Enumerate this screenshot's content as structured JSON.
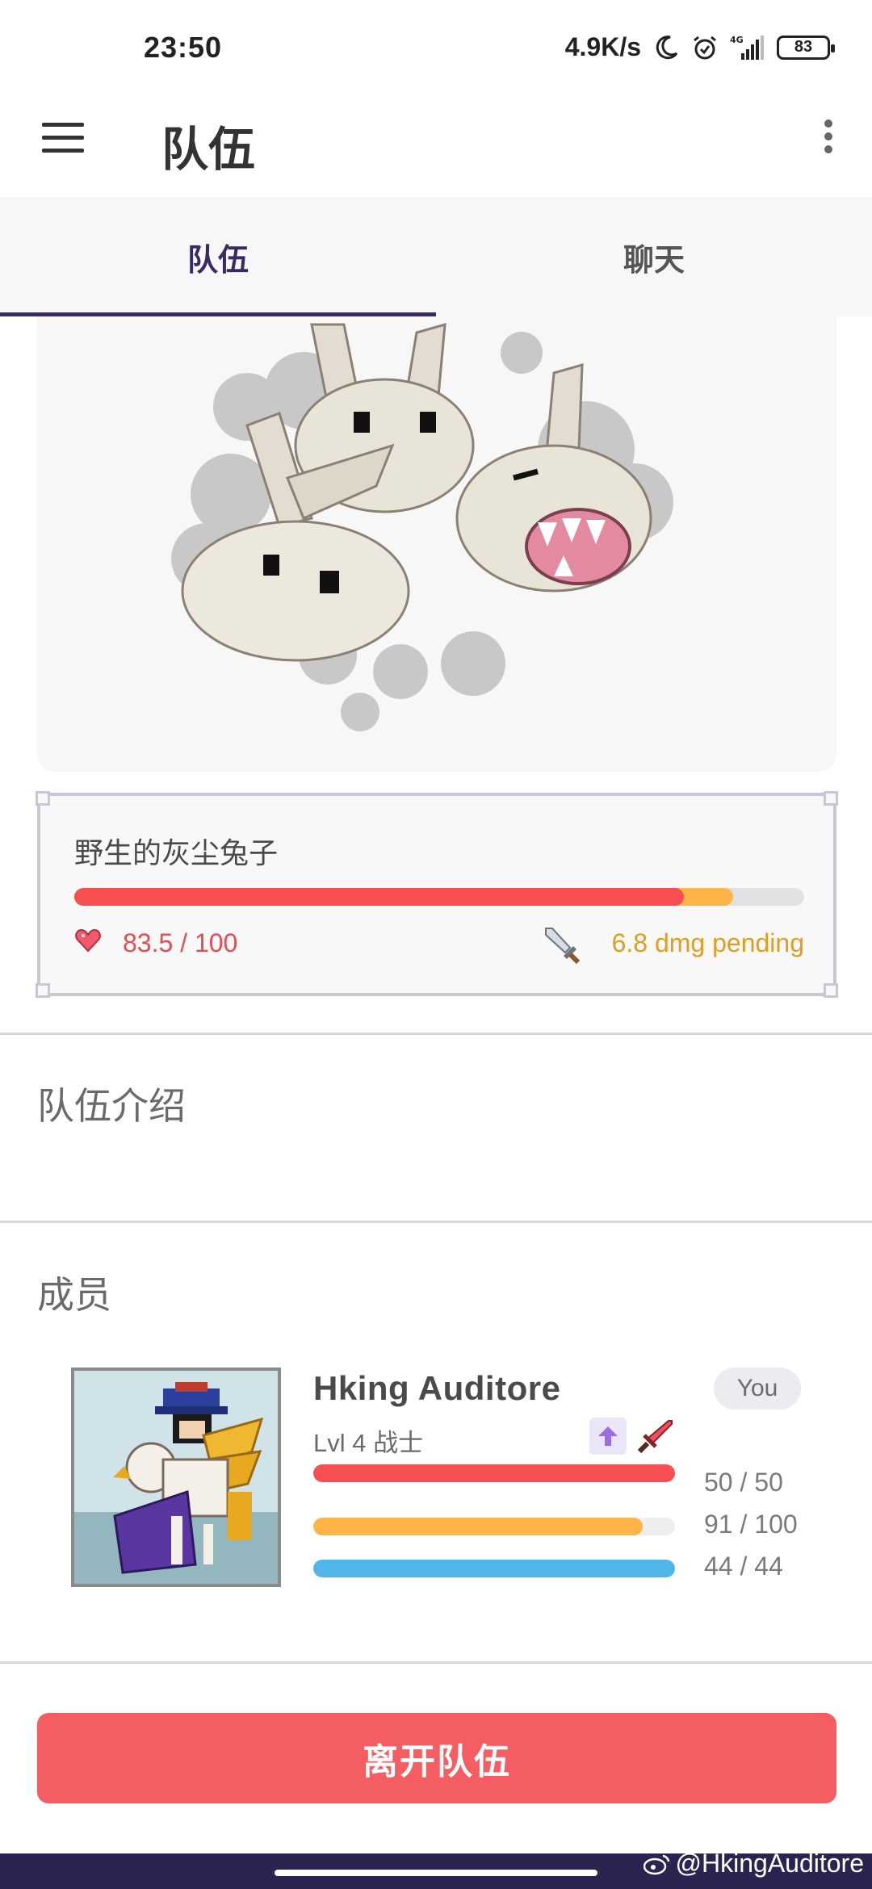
{
  "status_bar": {
    "time": "23:50",
    "network_speed": "4.9K/s",
    "network_type": "4G",
    "battery": "83"
  },
  "app_bar": {
    "title": "队伍"
  },
  "tabs": [
    {
      "label": "队伍",
      "active": true
    },
    {
      "label": "聊天",
      "active": false
    }
  ],
  "boss": {
    "name": "野生的灰尘兔子",
    "hp_text": "83.5 / 100",
    "hp_fraction": 0.835,
    "pending_text": "6.8 dmg pending",
    "pending_fraction": 0.068
  },
  "sections": {
    "description_title": "队伍介绍",
    "members_title": "成员"
  },
  "member": {
    "name": "Hking Auditore",
    "badge": "You",
    "level": "Lvl 4 战士",
    "hp_text": "50 / 50",
    "hp_fraction": 1.0,
    "exp_text": "91 / 100",
    "exp_fraction": 0.91,
    "mp_text": "44 / 44",
    "mp_fraction": 1.0
  },
  "actions": {
    "leave_label": "离开队伍"
  },
  "watermark": "@HkingAuditore",
  "colors": {
    "accent": "#3a2a63",
    "hp": "#f74e52",
    "pending": "#ffb445",
    "exp": "#ffb445",
    "mp": "#50b5e9",
    "leave_button": "#f45d62"
  }
}
